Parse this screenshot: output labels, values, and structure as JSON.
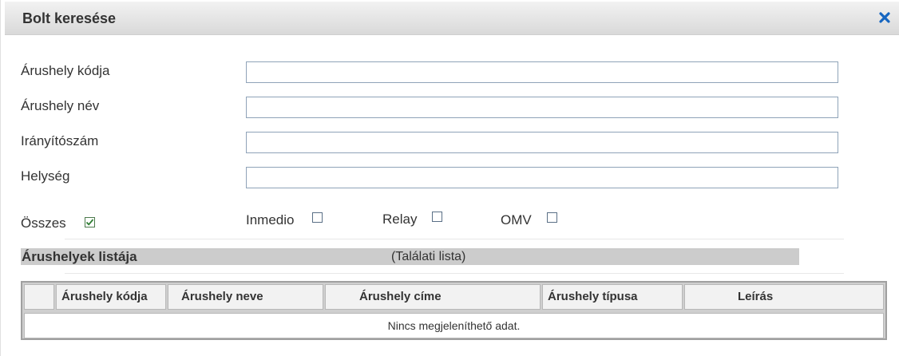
{
  "dialog": {
    "title": "Bolt keresése",
    "close_icon": "close-x-icon",
    "accent_color": "#1565c0"
  },
  "form": {
    "fields": [
      {
        "label": "Árushely kódja",
        "value": "",
        "placeholder": ""
      },
      {
        "label": "Árushely név",
        "value": "",
        "placeholder": ""
      },
      {
        "label": "Irányítószám",
        "value": "",
        "placeholder": ""
      },
      {
        "label": "Helység",
        "value": "",
        "placeholder": ""
      }
    ],
    "filters": [
      {
        "label": "Összes",
        "checked": true
      },
      {
        "label": "Inmedio",
        "checked": false
      },
      {
        "label": "Relay",
        "checked": false
      },
      {
        "label": "OMV",
        "checked": false
      }
    ]
  },
  "results": {
    "title": "Árushelyek listája",
    "subtitle": "(Találati lista)",
    "columns": [
      "",
      "Árushely kódja",
      "Árushely neve",
      "Árushely címe",
      "Árushely típusa",
      "Leírás"
    ],
    "empty_message": "Nincs megjeleníthető adat."
  }
}
